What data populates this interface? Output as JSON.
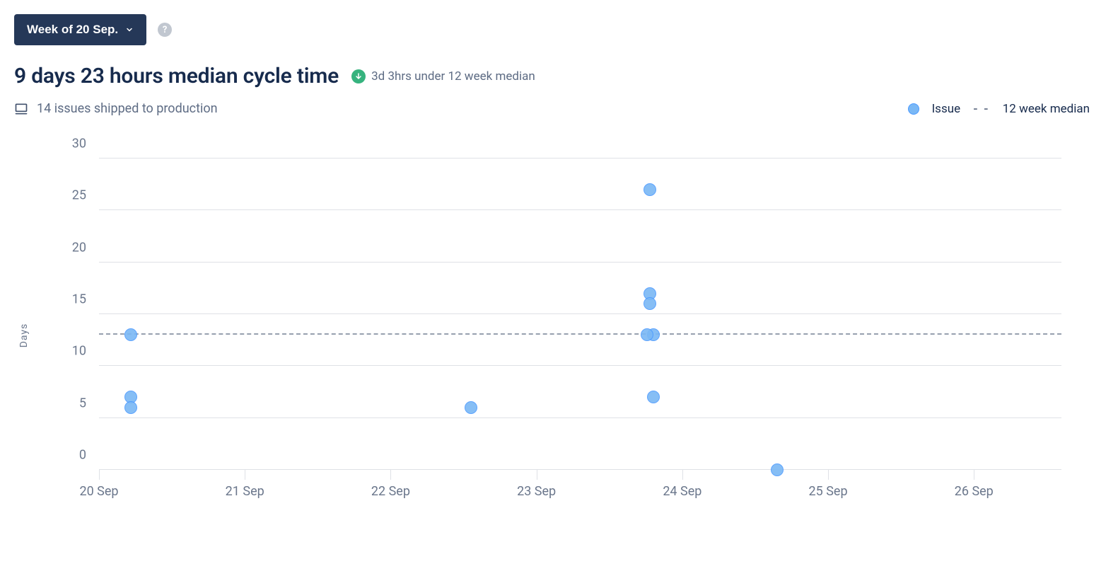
{
  "toolbar": {
    "week_label": "Week of 20 Sep."
  },
  "headline": {
    "title": "9 days 23 hours median cycle time",
    "delta_text": "3d 3hrs under 12 week median"
  },
  "sub": {
    "shipped_text": "14 issues shipped to production"
  },
  "legend": {
    "issue_label": "Issue",
    "median_label": "12 week median"
  },
  "chart_data": {
    "type": "scatter",
    "title": "",
    "xlabel": "",
    "ylabel": "Days",
    "ylim": [
      0,
      30
    ],
    "yticks": [
      0,
      5,
      10,
      15,
      20,
      25,
      30
    ],
    "x_categories": [
      "20 Sep",
      "21 Sep",
      "22 Sep",
      "23 Sep",
      "24 Sep",
      "25 Sep",
      "26 Sep"
    ],
    "reference_lines": [
      {
        "name": "12 week median",
        "y": 13
      }
    ],
    "series": [
      {
        "name": "Issue",
        "points": [
          {
            "x": 0.22,
            "y": 13
          },
          {
            "x": 0.22,
            "y": 7
          },
          {
            "x": 0.22,
            "y": 6
          },
          {
            "x": 2.55,
            "y": 6
          },
          {
            "x": 3.78,
            "y": 27
          },
          {
            "x": 3.78,
            "y": 17
          },
          {
            "x": 3.78,
            "y": 16
          },
          {
            "x": 3.8,
            "y": 13
          },
          {
            "x": 3.76,
            "y": 13
          },
          {
            "x": 3.8,
            "y": 7
          },
          {
            "x": 4.65,
            "y": 0
          }
        ]
      }
    ]
  }
}
